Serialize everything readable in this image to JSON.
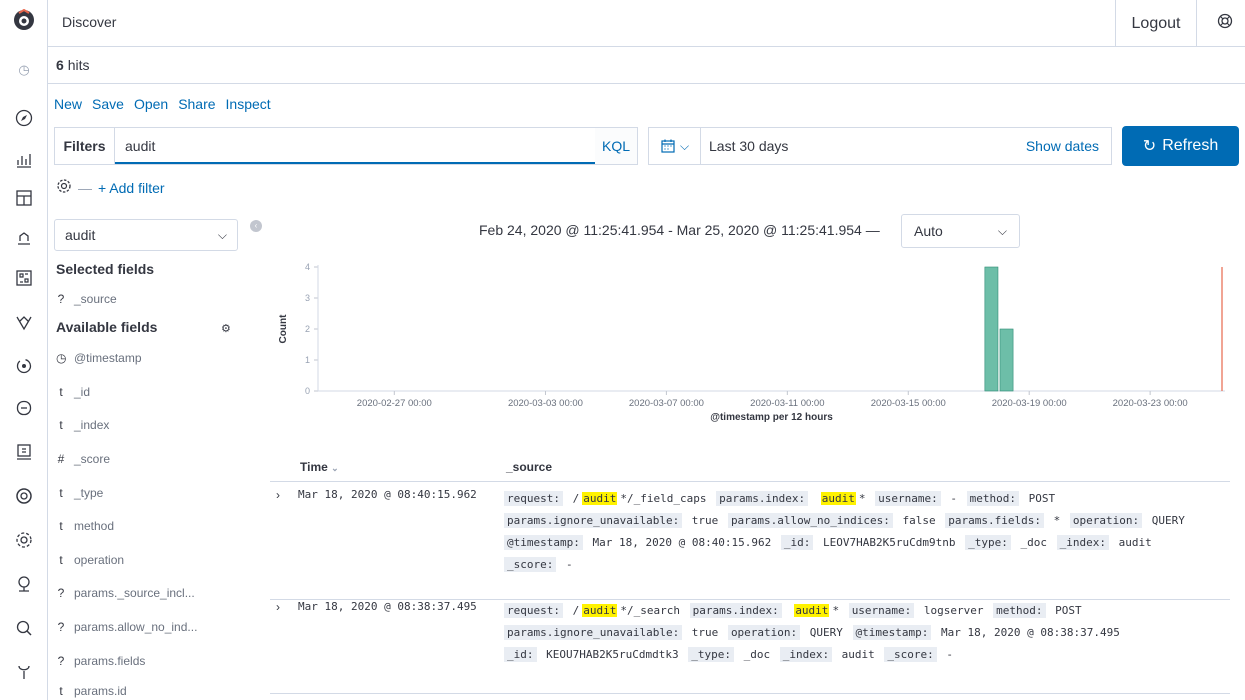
{
  "app": {
    "title": "Discover",
    "logout_label": "Logout"
  },
  "hits": {
    "count": "6",
    "label": "hits"
  },
  "menu": {
    "items": [
      "New",
      "Save",
      "Open",
      "Share",
      "Inspect"
    ]
  },
  "query": {
    "filters_label": "Filters",
    "value": "audit",
    "language": "KQL"
  },
  "timepicker": {
    "range": "Last 30 days",
    "show_dates": "Show dates",
    "refresh_label": "Refresh"
  },
  "filters": {
    "add_filter": "+ Add filter"
  },
  "sidebar": {
    "index_pattern": "audit",
    "selected_title": "Selected fields",
    "selected_fields": [
      {
        "type": "?",
        "name": "_source"
      }
    ],
    "available_title": "Available fields",
    "available_fields": [
      {
        "type": "clock",
        "name": "@timestamp"
      },
      {
        "type": "t",
        "name": "_id"
      },
      {
        "type": "t",
        "name": "_index"
      },
      {
        "type": "#",
        "name": "_score"
      },
      {
        "type": "t",
        "name": "_type"
      },
      {
        "type": "t",
        "name": "method"
      },
      {
        "type": "t",
        "name": "operation"
      },
      {
        "type": "?",
        "name": "params._source_incl..."
      },
      {
        "type": "?",
        "name": "params.allow_no_ind..."
      },
      {
        "type": "?",
        "name": "params.fields"
      },
      {
        "type": "t",
        "name": "params.id"
      }
    ]
  },
  "interval": {
    "range_text": "Feb 24, 2020 @ 11:25:41.954 - Mar 25, 2020 @ 11:25:41.954 —",
    "selected": "Auto"
  },
  "chart_data": {
    "type": "bar",
    "xlabel": "@timestamp per 12 hours",
    "ylabel": "Count",
    "ylim": [
      0,
      4
    ],
    "yticks": [
      "0",
      "1",
      "2",
      "3",
      "4"
    ],
    "xtick_labels": [
      "2020-02-27 00:00",
      "2020-03-03 00:00",
      "2020-03-07 00:00",
      "2020-03-11 00:00",
      "2020-03-15 00:00",
      "2020-03-19 00:00",
      "2020-03-23 00:00"
    ],
    "categories": [
      "2020-03-17 12:00",
      "2020-03-18 00:00"
    ],
    "values": [
      4,
      2
    ],
    "bar_color": "#54b399",
    "now_marker_color": "#e7664c"
  },
  "table": {
    "time_header": "Time",
    "source_header": "_source",
    "rows": [
      {
        "time": "Mar 18, 2020 @ 08:40:15.962",
        "lines": [
          [
            [
              "k",
              "request:"
            ],
            [
              "v",
              " /"
            ],
            [
              "h",
              "audit"
            ],
            [
              "v",
              "*/_field_caps "
            ],
            [
              "k",
              "params.index:"
            ],
            [
              "v",
              " "
            ],
            [
              "h",
              "audit"
            ],
            [
              "v",
              "* "
            ],
            [
              "k",
              "username:"
            ],
            [
              "v",
              " - "
            ],
            [
              "k",
              "method:"
            ],
            [
              "v",
              " POST"
            ]
          ],
          [
            [
              "k",
              "params.ignore_unavailable:"
            ],
            [
              "v",
              " true "
            ],
            [
              "k",
              "params.allow_no_indices:"
            ],
            [
              "v",
              " false "
            ],
            [
              "k",
              "params.fields:"
            ],
            [
              "v",
              " * "
            ],
            [
              "k",
              "operation:"
            ],
            [
              "v",
              " QUERY"
            ]
          ],
          [
            [
              "k",
              "@timestamp:"
            ],
            [
              "v",
              " Mar 18, 2020 @ 08:40:15.962 "
            ],
            [
              "k",
              "_id:"
            ],
            [
              "v",
              " LEOV7HAB2K5ruCdm9tnb "
            ],
            [
              "k",
              "_type:"
            ],
            [
              "v",
              " _doc "
            ],
            [
              "k",
              "_index:"
            ],
            [
              "v",
              " audit"
            ]
          ],
          [
            [
              "k",
              "_score:"
            ],
            [
              "v",
              " -"
            ]
          ]
        ]
      },
      {
        "time": "Mar 18, 2020 @ 08:38:37.495",
        "lines": [
          [
            [
              "k",
              "request:"
            ],
            [
              "v",
              " /"
            ],
            [
              "h",
              "audit"
            ],
            [
              "v",
              "*/_search "
            ],
            [
              "k",
              "params.index:"
            ],
            [
              "v",
              " "
            ],
            [
              "h",
              "audit"
            ],
            [
              "v",
              "* "
            ],
            [
              "k",
              "username:"
            ],
            [
              "v",
              " logserver "
            ],
            [
              "k",
              "method:"
            ],
            [
              "v",
              " POST"
            ]
          ],
          [
            [
              "k",
              "params.ignore_unavailable:"
            ],
            [
              "v",
              " true "
            ],
            [
              "k",
              "operation:"
            ],
            [
              "v",
              " QUERY "
            ],
            [
              "k",
              "@timestamp:"
            ],
            [
              "v",
              " Mar 18, 2020 @ 08:38:37.495"
            ]
          ],
          [
            [
              "k",
              "_id:"
            ],
            [
              "v",
              " KEOU7HAB2K5ruCdmdtk3 "
            ],
            [
              "k",
              "_type:"
            ],
            [
              "v",
              " _doc "
            ],
            [
              "k",
              "_index:"
            ],
            [
              "v",
              " audit "
            ],
            [
              "k",
              "_score:"
            ],
            [
              "v",
              " -"
            ]
          ]
        ]
      }
    ]
  }
}
